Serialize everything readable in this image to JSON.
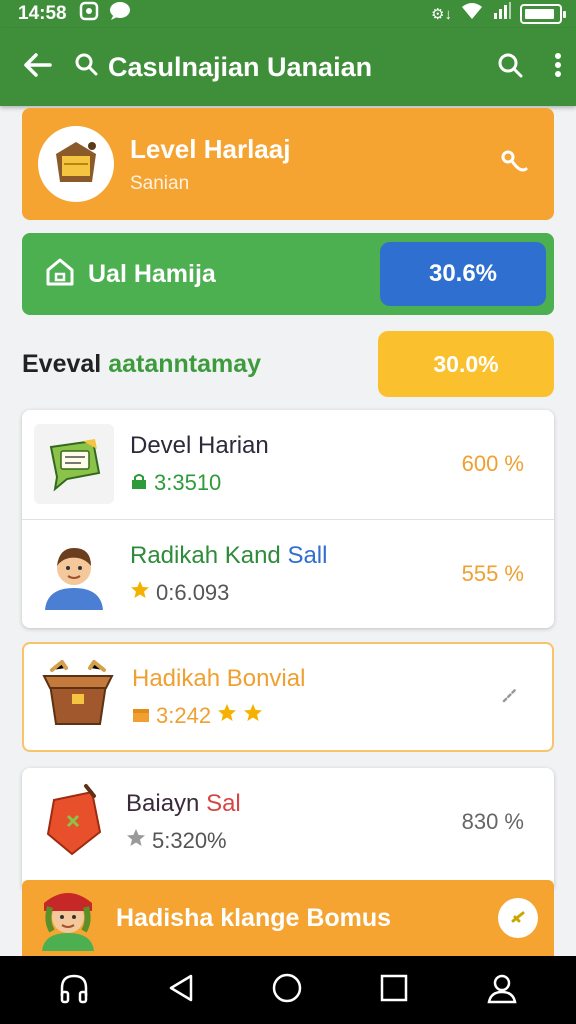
{
  "status_bar": {
    "time": "14:58",
    "icons_right": "⚙↓",
    "battery_level": 0.9
  },
  "app_bar": {
    "title": "Casulnajian Uanaian"
  },
  "level_card": {
    "title": "Level Harlaaj",
    "subtitle": "Sanian"
  },
  "green_card": {
    "label": "Ual Hamija",
    "value": "30.6%"
  },
  "section": {
    "title_prefix": "Eveval",
    "title_accent": "aatanntamay",
    "value": "30.0%"
  },
  "list_items": [
    {
      "title": "Devel Harian",
      "meta": "3:3510",
      "value": "600 %",
      "value_color": "#f0a030",
      "meta_color": "#2e9b3a"
    },
    {
      "title": "Radikah Kand",
      "title_suffix": "Sall",
      "meta": "0:6.093",
      "value": "555 %",
      "value_color": "#f0a030",
      "meta_color": "#555555"
    }
  ],
  "bonus_item": {
    "title": "Hadikah Bonvial",
    "meta": "3:242",
    "title_color": "#f0a030"
  },
  "plain_item": {
    "title": "Baiayn",
    "title_suffix": "Sal",
    "meta": "5:320%",
    "value": "830 %"
  },
  "bonus_bar": {
    "label": "Hadisha klange Bomus"
  },
  "colors": {
    "app_green": "#3f8f3a",
    "orange": "#f5a431",
    "green": "#4caf50",
    "blue": "#2f6fcf",
    "yellow": "#fbc02d"
  }
}
